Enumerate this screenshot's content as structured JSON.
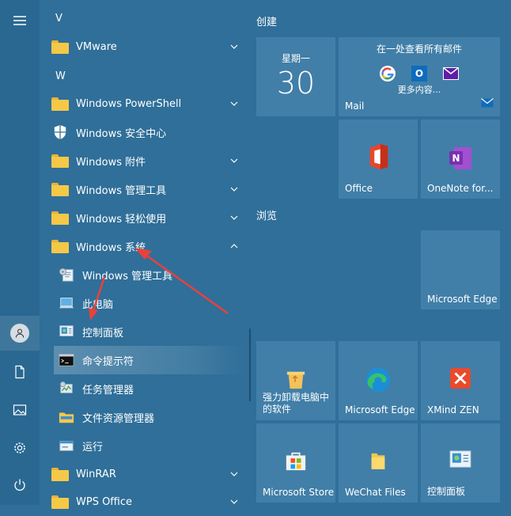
{
  "letters": {
    "v": "V",
    "w": "W"
  },
  "apps": {
    "vmware": "VMware",
    "powershell": "Windows PowerShell",
    "security": "Windows 安全中心",
    "accessories": "Windows 附件",
    "admin_tools": "Windows 管理工具",
    "ease": "Windows 轻松使用",
    "system": "Windows 系统",
    "sys_admin": "Windows 管理工具",
    "this_pc": "此电脑",
    "control_panel": "控制面板",
    "cmd": "命令提示符",
    "task_mgr": "任务管理器",
    "explorer": "文件资源管理器",
    "run": "运行",
    "winrar": "WinRAR",
    "wps": "WPS Office"
  },
  "groups": {
    "create": "创建",
    "browse": "浏览"
  },
  "tiles": {
    "calendar_day": "星期一",
    "calendar_date": "30",
    "mail_header": "在一处查看所有邮件",
    "mail_more": "更多内容...",
    "mail": "Mail",
    "office": "Office",
    "onenote": "OneNote for...",
    "edge1": "Microsoft Edge",
    "uninstall": "强力卸载电脑中的软件",
    "edge2": "Microsoft Edge",
    "xmind": "XMind ZEN",
    "store": "Microsoft Store",
    "wechat": "WeChat Files",
    "cpanel": "控制面板"
  },
  "colors": {
    "background": "#2f6f99",
    "tile": "#4f8cb4",
    "folder": "#f6c847",
    "arrow": "#e8423a"
  }
}
